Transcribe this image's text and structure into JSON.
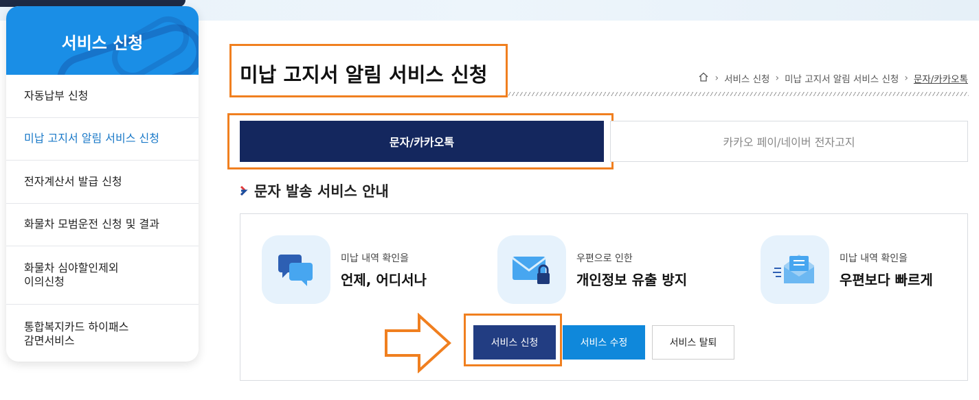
{
  "sidebar": {
    "title": "서비스 신청",
    "items": [
      {
        "label": "자동납부 신청"
      },
      {
        "label": "미납 고지서 알림 서비스 신청"
      },
      {
        "label": "전자계산서 발급 신청"
      },
      {
        "label": "화물차 모범운전 신청 및 결과"
      },
      {
        "label": "화물차 심야할인제외\n이의신청"
      },
      {
        "label": "통합복지카드 하이패스\n감면서비스"
      }
    ]
  },
  "header": {
    "title": "미납 고지서 알림 서비스 신청",
    "breadcrumb": [
      "서비스 신청",
      "미납 고지서 알림 서비스 신청",
      "문자/카카오톡"
    ]
  },
  "tabs": [
    {
      "label": "문자/카카오톡",
      "active": true
    },
    {
      "label": "카카오 페이/네이버 전자고지",
      "active": false
    }
  ],
  "section": {
    "heading": "문자 발송 서비스 안내"
  },
  "features": [
    {
      "icon": "chat-bubbles-icon",
      "sub": "미납 내역 확인을",
      "main": "언제, 어디서나"
    },
    {
      "icon": "locked-mail-icon",
      "sub": "우편으로 인한",
      "main": "개인정보 유출 방지"
    },
    {
      "icon": "fast-mail-icon",
      "sub": "미납 내역 확인을",
      "main": "우편보다 빠르게"
    }
  ],
  "buttons": {
    "apply": "서비스 신청",
    "modify": "서비스 수정",
    "cancel": "서비스 탈퇴"
  },
  "colors": {
    "accent_blue": "#1a8ee6",
    "navy": "#14275e",
    "highlight_orange": "#f07f1f"
  }
}
